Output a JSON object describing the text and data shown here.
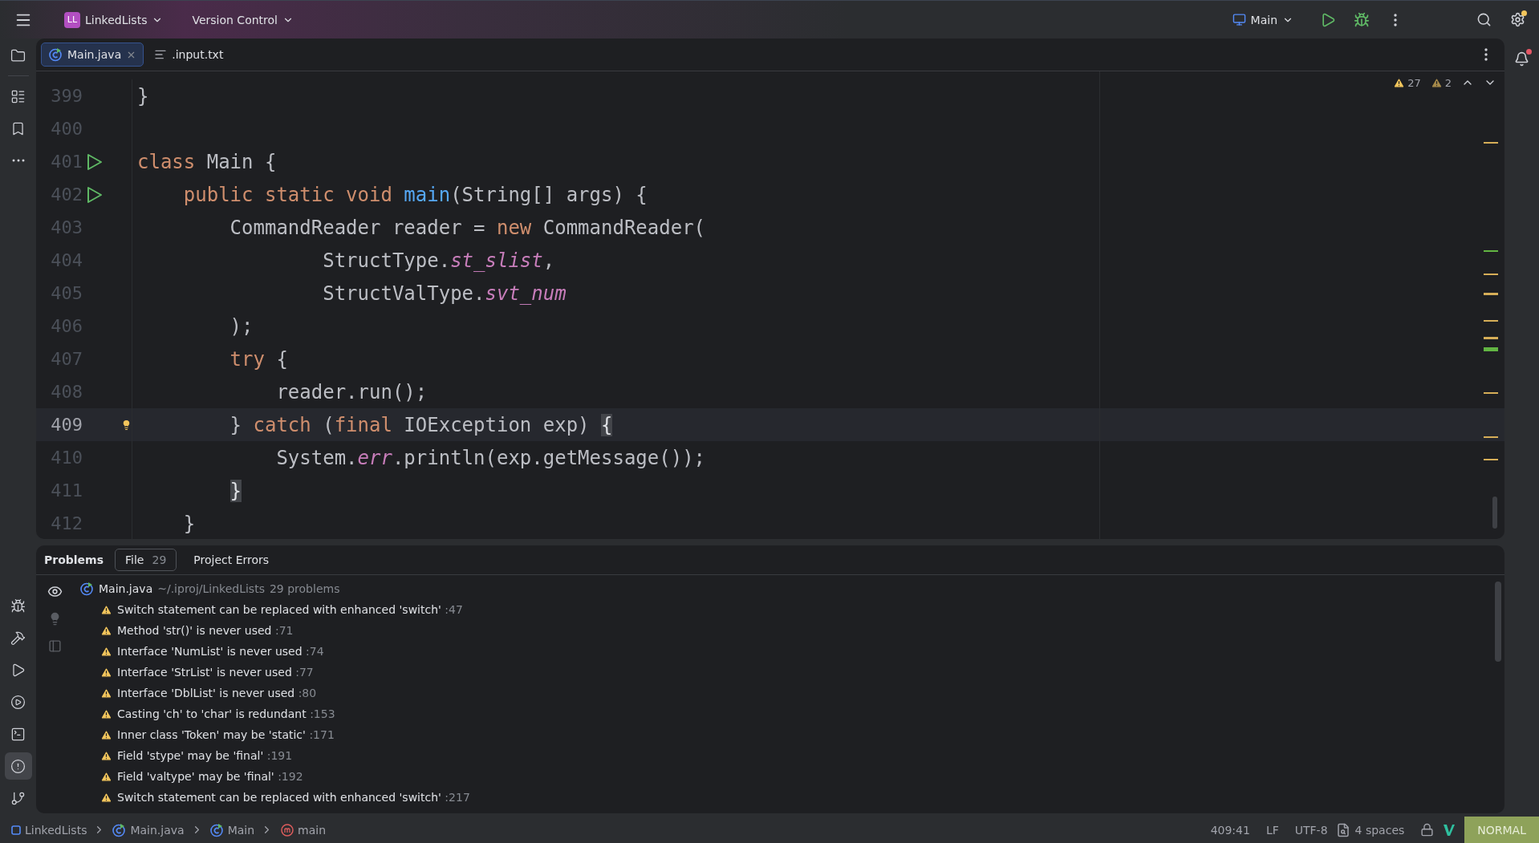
{
  "toolbar": {
    "project_badge": "LL",
    "project": "LinkedLists",
    "vcs": "Version Control",
    "run_config": "Main"
  },
  "left_tools": {
    "top": [
      {
        "kind": "project",
        "selected": false
      },
      {
        "kind": "structure",
        "selected": false
      },
      {
        "kind": "bookmarks",
        "selected": false
      },
      {
        "kind": "more",
        "selected": false
      }
    ],
    "bottom": [
      {
        "kind": "debug",
        "selected": false
      },
      {
        "kind": "build",
        "selected": false
      },
      {
        "kind": "run",
        "selected": false
      },
      {
        "kind": "services",
        "selected": false
      },
      {
        "kind": "terminal",
        "selected": false
      },
      {
        "kind": "problems",
        "selected": true
      },
      {
        "kind": "git",
        "selected": false
      }
    ]
  },
  "tabs": [
    {
      "label": "Main.java",
      "kind": "java",
      "selected": true
    },
    {
      "label": ".input.txt",
      "kind": "text",
      "selected": false
    }
  ],
  "inspections": [
    {
      "kind": "warning",
      "count": "27"
    },
    {
      "kind": "weak-warning",
      "count": "2"
    }
  ],
  "code": {
    "lines": [
      {
        "number": "399",
        "current": false,
        "run_marker": false,
        "bulb": false,
        "tokens": [
          {
            "text": "}",
            "kind": "plain"
          }
        ]
      },
      {
        "number": "400",
        "current": false,
        "run_marker": false,
        "bulb": false
      },
      {
        "number": "401",
        "current": false,
        "run_marker": true,
        "bulb": false,
        "tokens": [
          {
            "text": "class",
            "kind": "keyword"
          },
          {
            "text": " Main {",
            "kind": "plain"
          }
        ]
      },
      {
        "number": "402",
        "current": false,
        "run_marker": true,
        "bulb": false,
        "tokens": [
          {
            "text": "    public static void",
            "kind": "keyword"
          },
          {
            "text": " main",
            "kind": "declaration"
          },
          {
            "text": "(String[] args) {",
            "kind": "plain"
          }
        ]
      },
      {
        "number": "403",
        "current": false,
        "run_marker": false,
        "bulb": false,
        "tokens": [
          {
            "text": "        CommandReader reader = ",
            "kind": "plain"
          },
          {
            "text": "new",
            "kind": "keyword"
          },
          {
            "text": " CommandReader(",
            "kind": "plain"
          }
        ]
      },
      {
        "number": "404",
        "current": false,
        "run_marker": false,
        "bulb": false,
        "tokens": [
          {
            "text": "                StructType.",
            "kind": "plain"
          },
          {
            "text": "st_slist",
            "kind": "static"
          },
          {
            "text": ",",
            "kind": "plain"
          }
        ]
      },
      {
        "number": "405",
        "current": false,
        "run_marker": false,
        "bulb": false,
        "tokens": [
          {
            "text": "                StructValType.",
            "kind": "plain"
          },
          {
            "text": "svt_num",
            "kind": "static"
          }
        ]
      },
      {
        "number": "406",
        "current": false,
        "run_marker": false,
        "bulb": false,
        "tokens": [
          {
            "text": "        );",
            "kind": "plain"
          }
        ]
      },
      {
        "number": "407",
        "current": false,
        "run_marker": false,
        "bulb": false,
        "tokens": [
          {
            "text": "        try",
            "kind": "keyword"
          },
          {
            "text": " {",
            "kind": "plain"
          }
        ]
      },
      {
        "number": "408",
        "current": false,
        "run_marker": false,
        "bulb": false,
        "tokens": [
          {
            "text": "            reader.run();",
            "kind": "plain"
          }
        ]
      },
      {
        "number": "409",
        "current": true,
        "run_marker": false,
        "bulb": true,
        "tokens": [
          {
            "text": "        } ",
            "kind": "plain"
          },
          {
            "text": "catch",
            "kind": "keyword"
          },
          {
            "text": " (",
            "kind": "plain"
          },
          {
            "text": "final",
            "kind": "keyword"
          },
          {
            "text": " IOException exp) ",
            "kind": "plain"
          },
          {
            "text": "{",
            "kind": "brace-match"
          }
        ]
      },
      {
        "number": "410",
        "current": false,
        "run_marker": false,
        "bulb": false,
        "tokens": [
          {
            "text": "            System.",
            "kind": "plain"
          },
          {
            "text": "err",
            "kind": "static"
          },
          {
            "text": ".println(exp.getMessage());",
            "kind": "plain"
          }
        ]
      },
      {
        "number": "411",
        "current": false,
        "run_marker": false,
        "bulb": false,
        "tokens": [
          {
            "text": "        }",
            "kind": "brace-match"
          }
        ]
      },
      {
        "number": "412",
        "current": false,
        "run_marker": false,
        "bulb": false,
        "tokens": [
          {
            "text": "    }",
            "kind": "plain"
          }
        ]
      }
    ]
  },
  "problems": {
    "title": "Problems",
    "tabs": [
      {
        "label": "File",
        "count": "29",
        "selected": true
      },
      {
        "label": "Project Errors",
        "selected": false
      }
    ],
    "file": {
      "name": "Main.java",
      "path": "~/.iproj/LinkedLists",
      "summary": "29 problems",
      "items": [
        {
          "message": "Switch statement can be replaced with enhanced 'switch'",
          "line": ":47"
        },
        {
          "message": "Method 'str()' is never used",
          "line": ":71"
        },
        {
          "message": "Interface 'NumList' is never used",
          "line": ":74"
        },
        {
          "message": "Interface 'StrList' is never used",
          "line": ":77"
        },
        {
          "message": "Interface 'DblList' is never used",
          "line": ":80"
        },
        {
          "message": "Casting 'ch' to 'char' is redundant",
          "line": ":153"
        },
        {
          "message": "Inner class 'Token' may be 'static'",
          "line": ":171"
        },
        {
          "message": "Field 'stype' may be 'final'",
          "line": ":191"
        },
        {
          "message": "Field 'valtype' may be 'final'",
          "line": ":192"
        },
        {
          "message": "Switch statement can be replaced with enhanced 'switch'",
          "line": ":217"
        }
      ]
    }
  },
  "breadcrumbs": [
    {
      "label": "LinkedLists",
      "kind": "project"
    },
    {
      "label": "Main.java",
      "kind": "class"
    },
    {
      "label": "Main",
      "kind": "class"
    },
    {
      "label": "main",
      "kind": "method"
    }
  ],
  "status": {
    "position": "409:41",
    "line_ending": "LF",
    "encoding": "UTF-8",
    "indent": "4 spaces",
    "mode": "NORMAL"
  }
}
